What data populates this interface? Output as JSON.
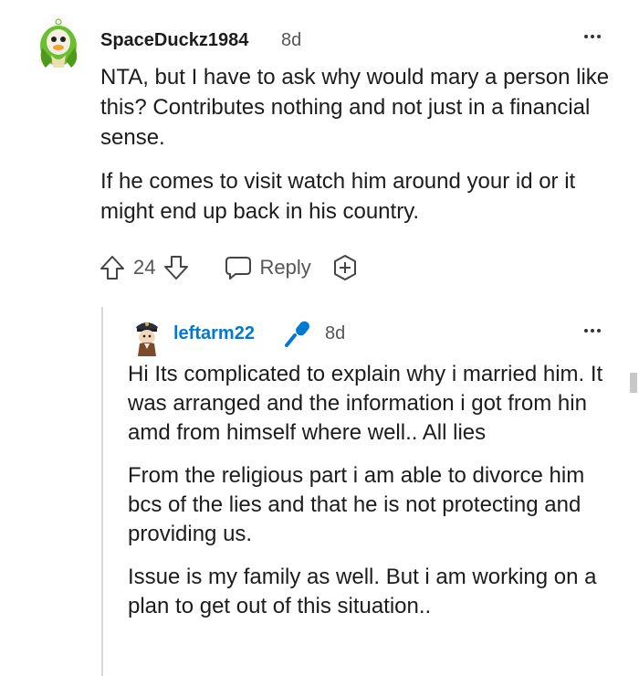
{
  "comment": {
    "author": "SpaceDuckz1984",
    "time": "8d",
    "paragraphs": [
      "NTA, but I have to ask why would mary a person like this? Contributes nothing and not just in a financial sense.",
      "If he comes to visit watch him around your id or it might end up back in his country."
    ],
    "vote_count": "24",
    "reply_label": "Reply",
    "icons": {
      "upvote": "arrow-up-icon",
      "downvote": "arrow-down-icon",
      "reply": "speech-bubble-icon",
      "award": "award-plus-icon",
      "more": "more-options-icon"
    }
  },
  "reply": {
    "author": "leftarm22",
    "time": "8d",
    "op_badge_icon": "microphone-icon",
    "paragraphs": [
      "Hi Its complicated to explain why i married him. It was arranged and the information i got from hin amd from himself where well.. All lies",
      "From the religious part i am able to divorce him bcs of the lies and that he is not protecting and providing us.",
      "Issue is my family as well. But i am working on a plan to get out of this situation.."
    ]
  },
  "colors": {
    "author_link": "#0079d3",
    "mic_badge": "#0079d3",
    "text": "#1c1c1c",
    "meta": "#555555"
  }
}
